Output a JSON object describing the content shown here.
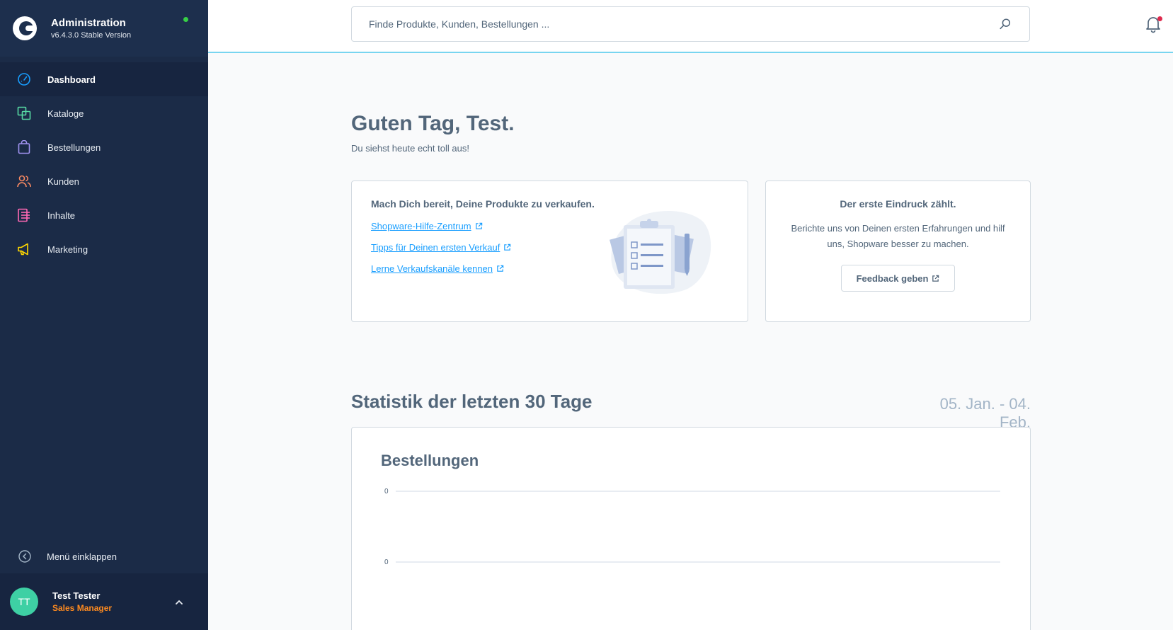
{
  "app": {
    "title": "Administration",
    "version": "v6.4.3.0 Stable Version"
  },
  "sidebar": {
    "items": [
      {
        "label": "Dashboard",
        "icon": "dashboard-icon",
        "color": "#189eff",
        "active": true
      },
      {
        "label": "Kataloge",
        "icon": "catalog-icon",
        "color": "#57d9a3"
      },
      {
        "label": "Bestellungen",
        "icon": "orders-icon",
        "color": "#a092f0"
      },
      {
        "label": "Kunden",
        "icon": "customers-icon",
        "color": "#f88962"
      },
      {
        "label": "Inhalte",
        "icon": "content-icon",
        "color": "#ff68b4"
      },
      {
        "label": "Marketing",
        "icon": "marketing-icon",
        "color": "#ffd700"
      }
    ],
    "collapse_label": "Menü einklappen",
    "user": {
      "initials": "TT",
      "name": "Test Tester",
      "role": "Sales Manager"
    }
  },
  "search": {
    "placeholder": "Finde Produkte, Kunden, Bestellungen ..."
  },
  "dashboard": {
    "greeting": "Guten Tag, Test.",
    "subtitle": "Du siehst heute echt toll aus!",
    "getting_started": {
      "title": "Mach Dich bereit, Deine Produkte zu verkaufen.",
      "links": [
        "Shopware-Hilfe-Zentrum",
        "Tipps für Deinen ersten Verkauf",
        "Lerne Verkaufskanäle kennen"
      ]
    },
    "feedback": {
      "title": "Der erste Eindruck zählt.",
      "text": "Berichte uns von Deinen ersten Erfahrungen und hilf uns, Shopware besser zu machen.",
      "button": "Feedback geben"
    },
    "statistics": {
      "title": "Statistik der letzten 30 Tage",
      "range": "05. Jan. - 04. Feb."
    }
  },
  "chart_data": {
    "type": "line",
    "title": "Bestellungen",
    "y_ticks": [
      "0",
      "0"
    ],
    "series": [],
    "grid": true
  },
  "colors": {
    "sidebar": "#1b2b47",
    "accent": "#189eff",
    "online": "#37d046",
    "notification": "#de294c",
    "role": "#ff8b1f"
  }
}
